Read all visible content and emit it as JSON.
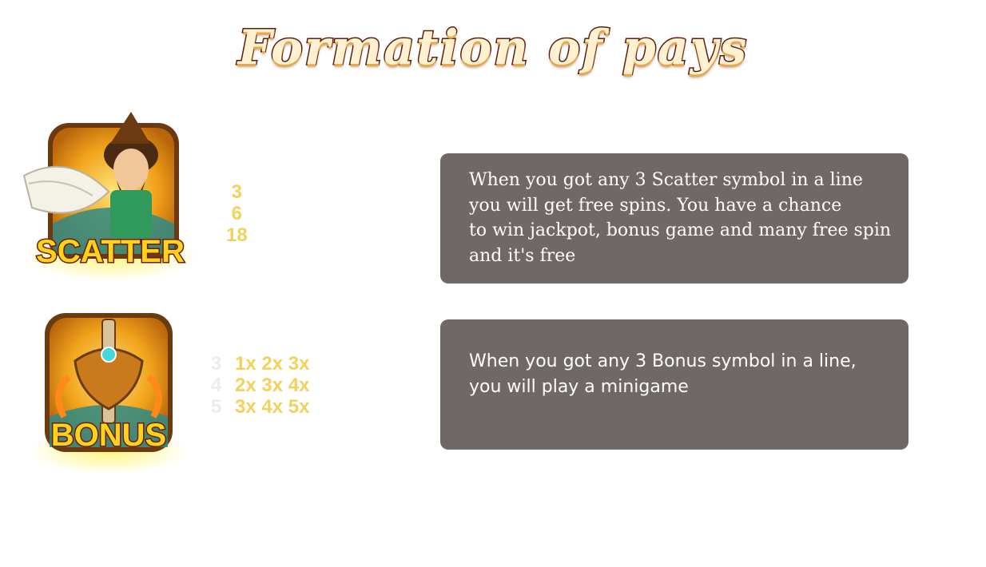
{
  "title": "Formation of pays",
  "scatter": {
    "symbol_label": "SCATTER",
    "pays": [
      "3",
      "6",
      "18"
    ],
    "description_lines": [
      "When you got any 3 Scatter symbol in a line",
      "you will get free spins. You have a chance",
      "to win jackpot, bonus game and many free spin",
      "and it's free"
    ]
  },
  "bonus": {
    "symbol_label": "BONUS",
    "pays": [
      {
        "count": "3",
        "value": "1x 2x 3x"
      },
      {
        "count": "4",
        "value": "2x 3x 4x"
      },
      {
        "count": "5",
        "value": "3x 4x 5x"
      }
    ],
    "description_lines": [
      "When you got any 3 Bonus symbol in a line,",
      "you will play a minigame"
    ]
  },
  "colors": {
    "box_background": "#6f6866",
    "pay_value": "#f4d15c",
    "pay_count": "#ececec",
    "symbol_gold": "#f0a21a"
  }
}
